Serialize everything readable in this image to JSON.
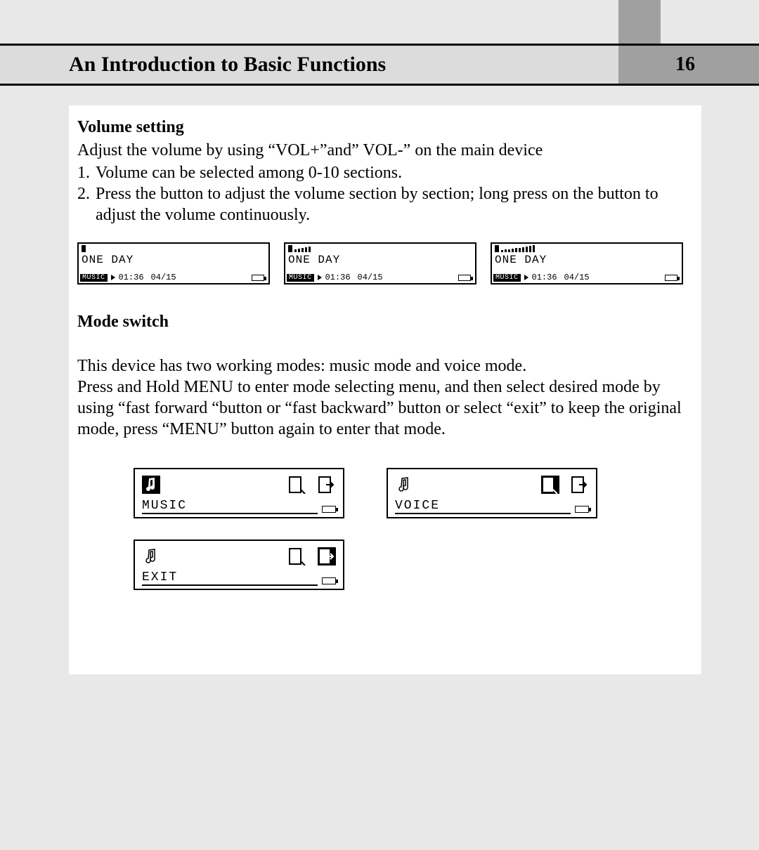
{
  "header": {
    "title": "An Introduction to Basic Functions",
    "page_number": "16"
  },
  "volume_section": {
    "heading": "Volume setting",
    "intro": "Adjust the volume by using “VOL+”and” VOL-” on the main device",
    "items": [
      "Volume can be selected among 0-10 sections.",
      "Press the button to adjust the volume section by section; long press on the button to adjust the volume continuously."
    ]
  },
  "volume_screens": [
    {
      "volume_level": 0,
      "track": "ONE DAY",
      "mode_badge": "MUSIC",
      "time": "01:36",
      "index": "04/15"
    },
    {
      "volume_level": 5,
      "track": "ONE DAY",
      "mode_badge": "MUSIC",
      "time": "01:36",
      "index": "04/15"
    },
    {
      "volume_level": 10,
      "track": "ONE DAY",
      "mode_badge": "MUSIC",
      "time": "01:36",
      "index": "04/15"
    }
  ],
  "mode_section": {
    "heading": "Mode switch",
    "paragraph": "This device has two working modes: music mode and voice mode.\nPress and Hold MENU to enter mode selecting menu, and then select desired mode by using “fast forward “button or “fast backward” button or select “exit” to keep the original mode, press “MENU” button again to enter that mode."
  },
  "mode_screens": [
    {
      "label": "MUSIC",
      "selected_icon": "music"
    },
    {
      "label": "VOICE",
      "selected_icon": "voice"
    },
    {
      "label": "EXIT",
      "selected_icon": "exit"
    }
  ],
  "icons": {
    "speaker": "speaker-icon",
    "play": "play-icon",
    "battery": "battery-icon",
    "music": "music-note-icon",
    "voice": "voice-mic-icon",
    "exit": "exit-door-icon"
  }
}
